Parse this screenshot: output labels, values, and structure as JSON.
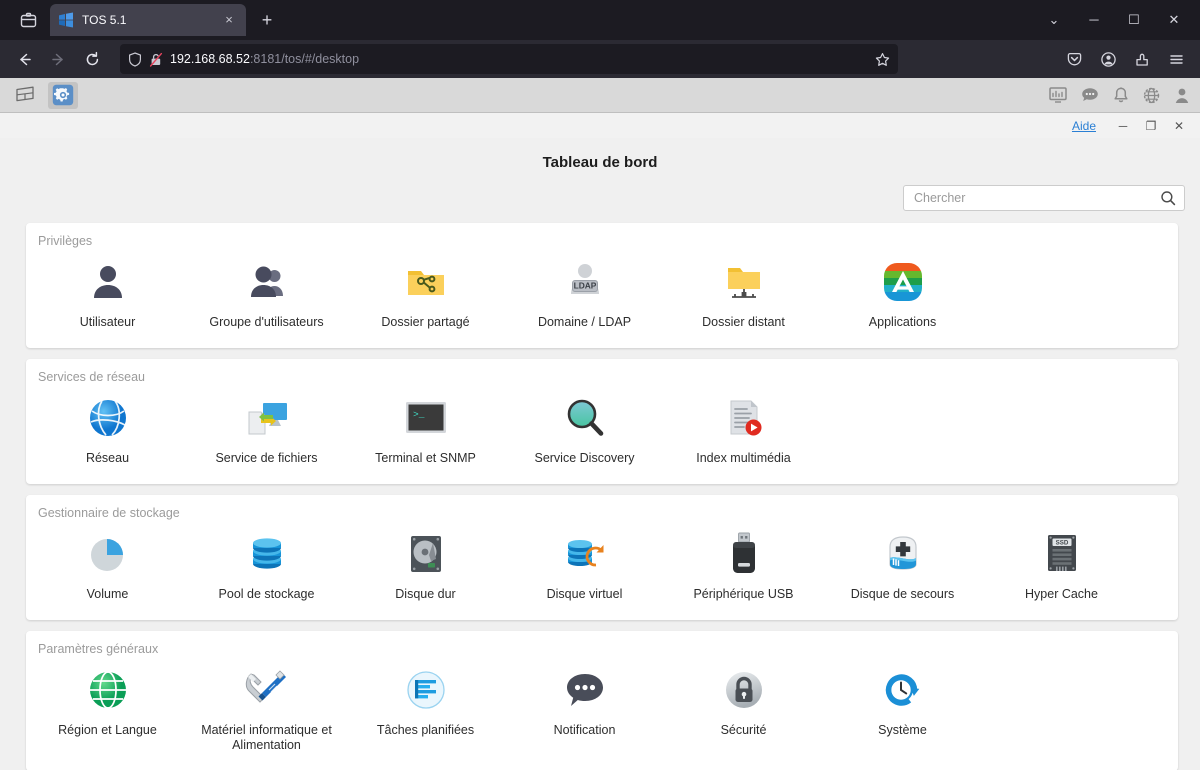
{
  "browser": {
    "tab": {
      "title": "TOS 5.1",
      "favicon": "tos-logo-icon",
      "close_label": "×"
    },
    "new_tab_label": "+",
    "firefox_view_icon": "firefox-view-icon",
    "window_controls": {
      "list_all_tabs": "⌄",
      "minimize": "─",
      "maximize": "☐",
      "close": "✕"
    },
    "nav": {
      "back": "←",
      "forward": "→",
      "reload": "↻"
    },
    "url": {
      "host": "192.168.68.52",
      "suffix": ":8181/tos/#/desktop",
      "shield_icon": "shield-icon",
      "lock_icon": "broken-lock-icon",
      "bookmark_icon": "star-icon"
    },
    "toolbar_end": {
      "pocket": "pocket-icon",
      "account": "account-icon",
      "extensions": "extensions-icon",
      "menu": "hamburger-menu-icon"
    }
  },
  "app": {
    "toolbar": {
      "desktop_icon": "desktop-perspective-icon",
      "control_panel_icon": "gear-icon",
      "end_icons": [
        "resource-monitor-icon",
        "chat-icon",
        "notification-bell-icon",
        "network-globe-icon",
        "user-account-icon"
      ]
    },
    "window": {
      "help_label": "Aide",
      "minimize": "─",
      "maximize": "❐",
      "close": "✕"
    },
    "title": "Tableau de bord",
    "search": {
      "placeholder": "Chercher",
      "value": "",
      "icon": "search-icon"
    },
    "sections": [
      {
        "title": "Privilèges",
        "items": [
          {
            "label": "Utilisateur",
            "icon": "user-icon"
          },
          {
            "label": "Groupe d'utilisateurs",
            "icon": "user-group-icon"
          },
          {
            "label": "Dossier partagé",
            "icon": "shared-folder-icon"
          },
          {
            "label": "Domaine / LDAP",
            "icon": "ldap-domain-icon",
            "badge": "LDAP"
          },
          {
            "label": "Dossier distant",
            "icon": "remote-folder-icon"
          },
          {
            "label": "Applications",
            "icon": "applications-icon"
          }
        ]
      },
      {
        "title": "Services de réseau",
        "items": [
          {
            "label": "Réseau",
            "icon": "network-globe-icon"
          },
          {
            "label": "Service de fichiers",
            "icon": "file-service-icon"
          },
          {
            "label": "Terminal et SNMP",
            "icon": "terminal-icon",
            "badge": ">_"
          },
          {
            "label": "Service Discovery",
            "icon": "service-discovery-icon"
          },
          {
            "label": "Index multimédia",
            "icon": "media-index-icon"
          }
        ]
      },
      {
        "title": "Gestionnaire de stockage",
        "items": [
          {
            "label": "Volume",
            "icon": "volume-pie-icon"
          },
          {
            "label": "Pool de stockage",
            "icon": "storage-pool-icon"
          },
          {
            "label": "Disque dur",
            "icon": "hard-disk-icon"
          },
          {
            "label": "Disque virtuel",
            "icon": "virtual-disk-icon"
          },
          {
            "label": "Périphérique USB",
            "icon": "usb-device-icon"
          },
          {
            "label": "Disque de secours",
            "icon": "spare-disk-icon"
          },
          {
            "label": "Hyper Cache",
            "icon": "ssd-cache-icon",
            "badge": "SSD"
          }
        ]
      },
      {
        "title": "Paramètres généraux",
        "items": [
          {
            "label": "Région et Langue",
            "icon": "region-globe-icon"
          },
          {
            "label": "Matériel informatique et Alimentation",
            "icon": "hardware-power-icon"
          },
          {
            "label": "Tâches planifiées",
            "icon": "scheduled-tasks-icon"
          },
          {
            "label": "Notification",
            "icon": "notification-bubble-icon"
          },
          {
            "label": "Sécurité",
            "icon": "lock-icon"
          },
          {
            "label": "Système",
            "icon": "system-clock-icon"
          }
        ]
      }
    ]
  },
  "colors": {
    "chrome_bg": "#2b2a33",
    "tabstrip_bg": "#1c1b22",
    "accent_blue": "#2a7fd4",
    "folder_yellow": "#f5c033",
    "card_white": "#ffffff",
    "page_bg": "#f0f0f0"
  }
}
